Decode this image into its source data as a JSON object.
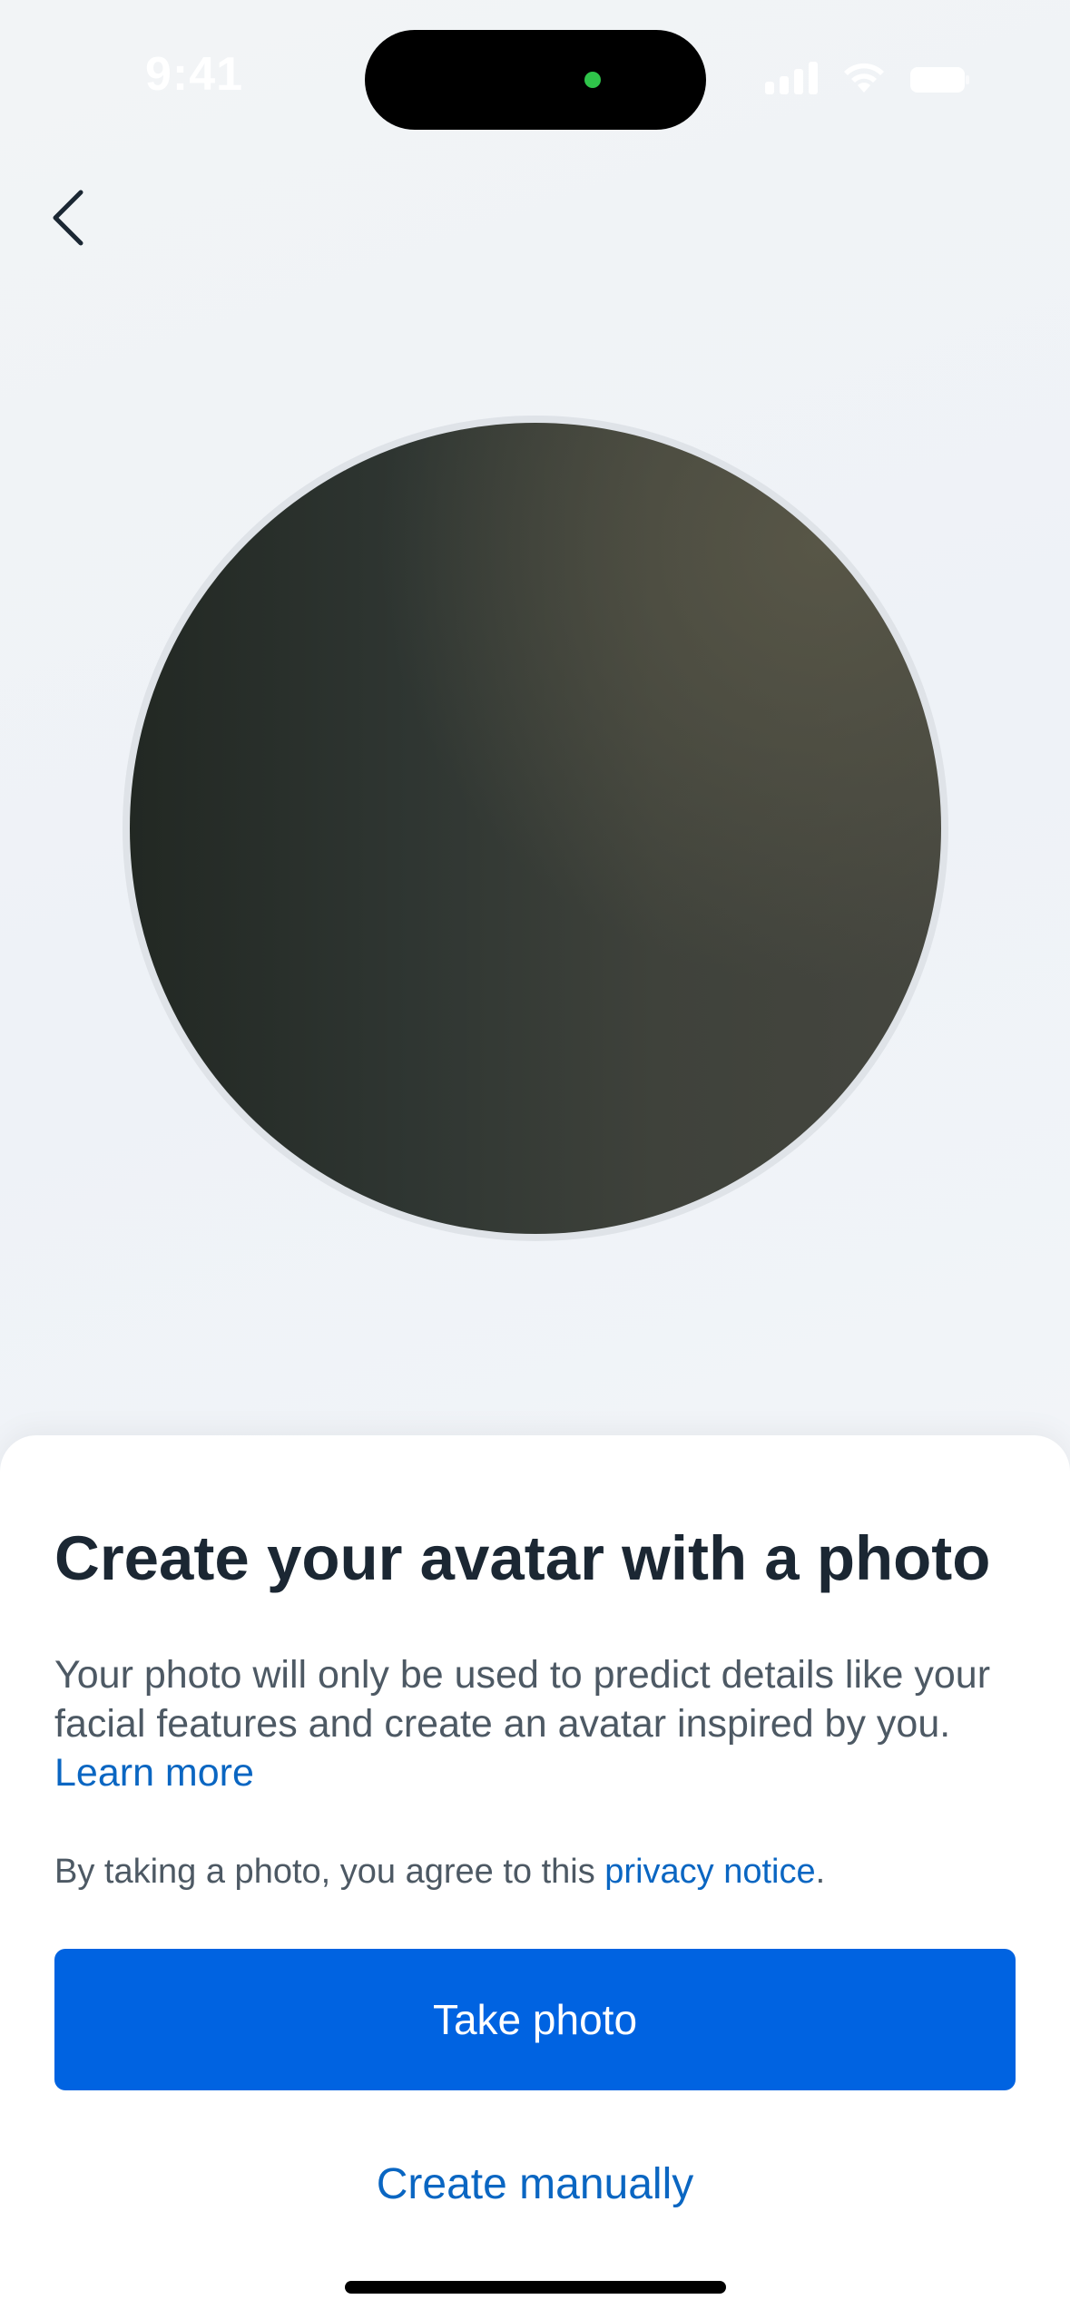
{
  "status_bar": {
    "time": "9:41",
    "icons": [
      "cellular-signal-icon",
      "wifi-icon",
      "battery-icon"
    ]
  },
  "nav": {
    "back_icon": "chevron-left-icon"
  },
  "avatar_preview": {
    "description_icon": "camera-preview"
  },
  "sheet": {
    "title": "Create your avatar with a photo",
    "description": "Your photo will only be used to predict details like your facial features and create an avatar inspired by you.",
    "learn_more": "Learn more",
    "privacy_prefix": "By taking a photo, you agree to this",
    "privacy_link": "privacy notice",
    "privacy_suffix": ".",
    "take_photo": "Take photo",
    "create_manually": "Create manually"
  },
  "colors": {
    "primary": "#0063e1",
    "link": "#0a66c2",
    "title": "#1b2733",
    "body": "#4d5964"
  }
}
